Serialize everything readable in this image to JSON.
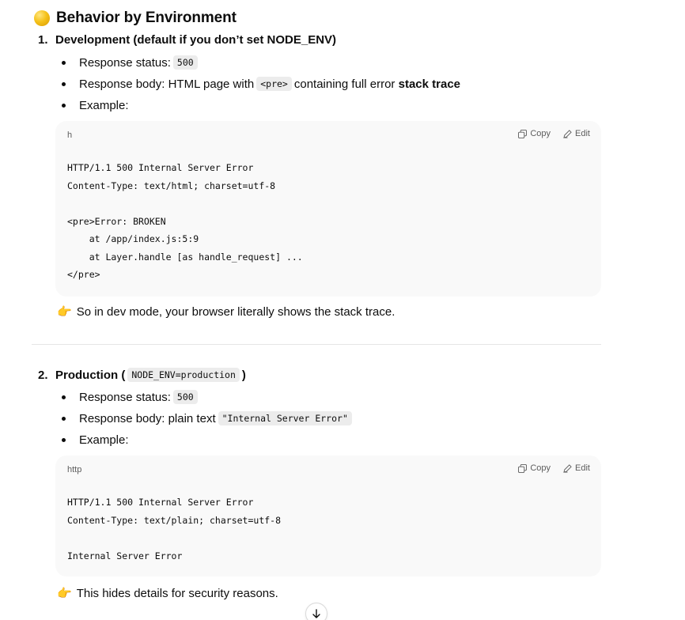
{
  "heading": {
    "title": "Behavior by Environment"
  },
  "section1": {
    "number": "1.",
    "title": "Development (default if you don’t set NODE_ENV)",
    "bullets": {
      "status_label": "Response status:",
      "status_value": "500",
      "body_label": "Response body: HTML page with",
      "body_code": "<pre>",
      "body_mid": "containing full error",
      "body_bold": "stack trace",
      "example_label": "Example:"
    },
    "code": {
      "lang": "h",
      "copy_label": "Copy",
      "edit_label": "Edit",
      "content": "HTTP/1.1 500 Internal Server Error\nContent-Type: text/html; charset=utf-8\n\n<pre>Error: BROKEN\n    at /app/index.js:5:9\n    at Layer.handle [as handle_request] ...\n</pre>"
    },
    "note": "So in dev mode, your browser literally shows the stack trace."
  },
  "section2": {
    "number": "2.",
    "title": "Production",
    "paren_open": "(",
    "env_code": "NODE_ENV=production",
    "paren_close": ")",
    "bullets": {
      "status_label": "Response status:",
      "status_value": "500",
      "body_label": "Response body: plain text",
      "body_code": "\"Internal Server Error\"",
      "example_label": "Example:"
    },
    "code": {
      "lang": "http",
      "copy_label": "Copy",
      "edit_label": "Edit",
      "content": "HTTP/1.1 500 Internal Server Error\nContent-Type: text/plain; charset=utf-8\n\nInternal Server Error"
    },
    "note": "This hides details for security reasons."
  },
  "icons": {
    "note_icon": "👉",
    "copy_icon": "copy-icon",
    "edit_icon": "edit-icon",
    "scroll_icon": "arrow-down-icon"
  }
}
